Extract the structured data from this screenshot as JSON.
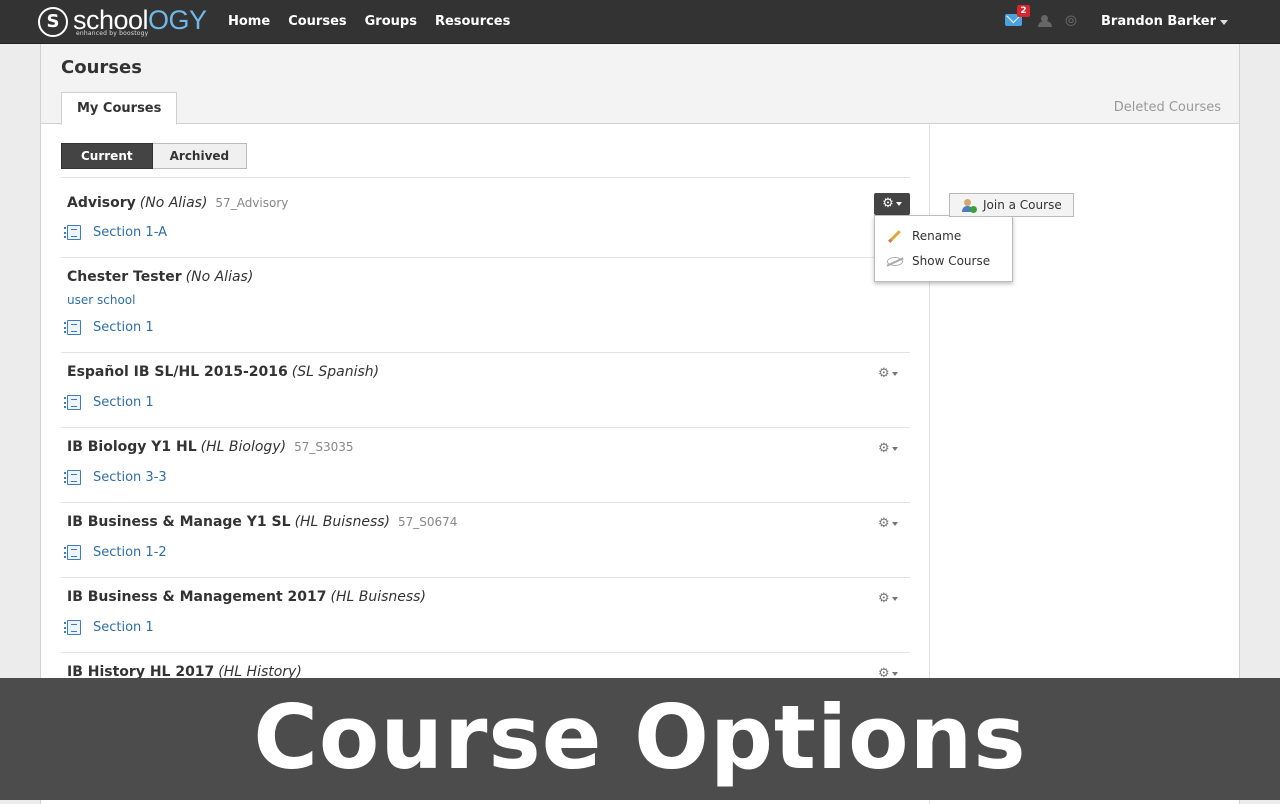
{
  "brand": {
    "letter": "S",
    "word_a": "school",
    "word_b": "OGY",
    "tagline": "enhanced by boostogy"
  },
  "nav": {
    "items": [
      "Home",
      "Courses",
      "Groups",
      "Resources"
    ]
  },
  "header_right": {
    "mail_badge": "2",
    "user_name": "Brandon Barker",
    "icons": [
      "mail-icon",
      "people-icon",
      "signal-icon"
    ]
  },
  "page": {
    "title": "Courses",
    "tab": "My Courses",
    "deleted_link": "Deleted Courses",
    "segment": [
      "Current",
      "Archived"
    ],
    "selected_segment": "Current"
  },
  "courses": [
    {
      "name": "Advisory",
      "alias": "(No Alias)",
      "code": "57_Advisory",
      "sub": "",
      "section": "Section 1-A"
    },
    {
      "name": "Chester Tester",
      "alias": "(No Alias)",
      "code": "",
      "sub": "user school",
      "section": "Section 1"
    },
    {
      "name": "Español IB SL/HL 2015-2016",
      "alias": "(SL Spanish)",
      "code": "",
      "sub": "",
      "section": "Section 1"
    },
    {
      "name": "IB Biology Y1 HL",
      "alias": "(HL Biology)",
      "code": "57_S3035",
      "sub": "",
      "section": "Section 3-3"
    },
    {
      "name": "IB Business & Manage Y1 SL",
      "alias": "(HL Buisness)",
      "code": "57_S0674",
      "sub": "",
      "section": "Section 1-2"
    },
    {
      "name": "IB Business & Management 2017",
      "alias": "(HL Buisness)",
      "code": "",
      "sub": "",
      "section": "Section 1"
    },
    {
      "name": "IB History HL 2017",
      "alias": "(HL History)",
      "code": "",
      "sub": "",
      "section": ""
    }
  ],
  "gear_menu": {
    "items": [
      "Rename",
      "Show Course"
    ]
  },
  "sidebar": {
    "join_label": "Join a Course"
  },
  "banner": {
    "text": "Course Options"
  },
  "colors": {
    "topbar": "#333333",
    "link": "#2f6fa6",
    "accent": "#6fb8e8",
    "badge": "#d9262c",
    "banner": "#4c4c4c"
  }
}
